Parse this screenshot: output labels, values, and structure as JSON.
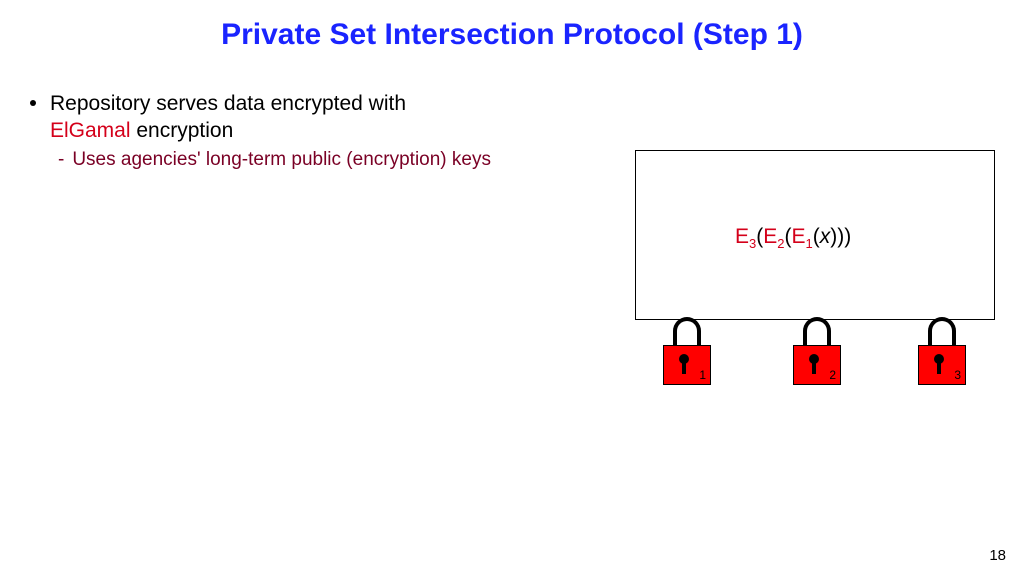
{
  "title": "Private Set Intersection Protocol (Step 1)",
  "bullet": {
    "line1": "Repository serves data encrypted with ",
    "elgamal": "ElGamal",
    "line2": " encryption",
    "sub": "Uses agencies' long-term public (encryption) keys"
  },
  "expr": {
    "E": "E",
    "s3": "3",
    "s2": "2",
    "s1": "1",
    "x": "x"
  },
  "locks": {
    "n1": "1",
    "n2": "2",
    "n3": "3"
  },
  "page": "18"
}
